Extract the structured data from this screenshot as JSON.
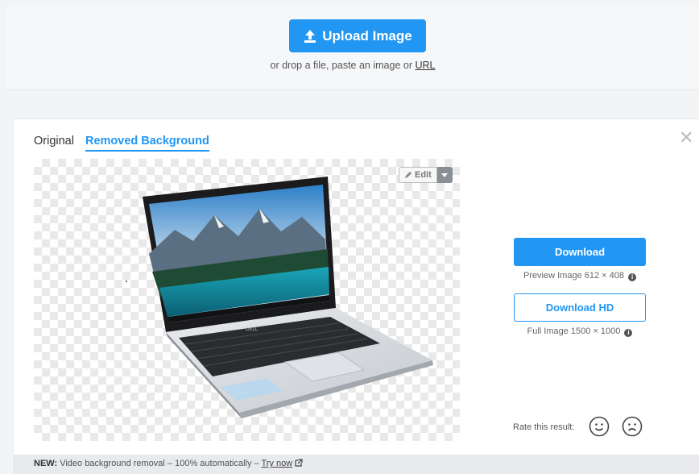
{
  "upload": {
    "button_label": "Upload Image",
    "drop_text": "or drop a file, paste an image or",
    "url_link": "URL"
  },
  "result": {
    "tabs": [
      {
        "label": "Original",
        "active": false
      },
      {
        "label": "Removed Background",
        "active": true
      }
    ],
    "edit_label": "Edit",
    "download_label": "Download",
    "preview_info": "Preview Image 612 × 408",
    "download_hd_label": "Download HD",
    "full_info": "Full Image 1500 × 1000",
    "rate_label": "Rate this result:"
  },
  "footer": {
    "new_label": "NEW:",
    "text": "Video background removal – 100% automatically –",
    "link": "Try now"
  },
  "colors": {
    "accent": "#2196f3",
    "checker": "#e9e9e9"
  },
  "icons": [
    "upload-icon",
    "close-icon",
    "pencil-icon",
    "caret-down-icon",
    "info-icon",
    "smile-icon",
    "frown-icon",
    "external-link-icon"
  ]
}
